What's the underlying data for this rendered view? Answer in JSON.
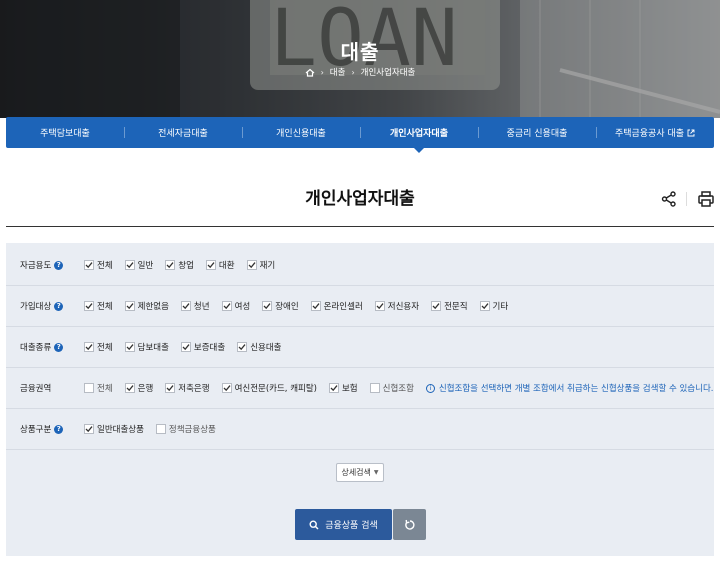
{
  "hero": {
    "title": "대출",
    "breadcrumb": [
      "대출",
      "개인사업자대출"
    ]
  },
  "tabs": [
    {
      "label": "주택담보대출",
      "active": false,
      "external": false
    },
    {
      "label": "전세자금대출",
      "active": false,
      "external": false
    },
    {
      "label": "개인신용대출",
      "active": false,
      "external": false
    },
    {
      "label": "개인사업자대출",
      "active": true,
      "external": false
    },
    {
      "label": "중금리 신용대출",
      "active": false,
      "external": false
    },
    {
      "label": "주택금융공사 대출",
      "active": false,
      "external": true
    }
  ],
  "page": {
    "title": "개인사업자대출"
  },
  "filters": [
    {
      "label": "자금용도",
      "help": true,
      "options": [
        {
          "text": "전체",
          "checked": true
        },
        {
          "text": "일반",
          "checked": true
        },
        {
          "text": "창업",
          "checked": true
        },
        {
          "text": "대환",
          "checked": true
        },
        {
          "text": "재기",
          "checked": true
        }
      ]
    },
    {
      "label": "가입대상",
      "help": true,
      "options": [
        {
          "text": "전체",
          "checked": true
        },
        {
          "text": "제한없음",
          "checked": true
        },
        {
          "text": "청년",
          "checked": true
        },
        {
          "text": "여성",
          "checked": true
        },
        {
          "text": "장애인",
          "checked": true
        },
        {
          "text": "온라인셀러",
          "checked": true
        },
        {
          "text": "저신용자",
          "checked": true
        },
        {
          "text": "전문직",
          "checked": true
        },
        {
          "text": "기타",
          "checked": true
        }
      ]
    },
    {
      "label": "대출종류",
      "help": true,
      "options": [
        {
          "text": "전체",
          "checked": true
        },
        {
          "text": "담보대출",
          "checked": true
        },
        {
          "text": "보증대출",
          "checked": true
        },
        {
          "text": "신용대출",
          "checked": true
        }
      ]
    },
    {
      "label": "금융권역",
      "help": false,
      "options": [
        {
          "text": "전체",
          "checked": false
        },
        {
          "text": "은행",
          "checked": true
        },
        {
          "text": "저축은행",
          "checked": true
        },
        {
          "text": "여신전문(카드, 캐피탈)",
          "checked": true
        },
        {
          "text": "보험",
          "checked": true
        },
        {
          "text": "신협조합",
          "checked": false
        }
      ],
      "info": "신협조합을 선택하면 개별 조합에서 취급하는 신협상품을 검색할 수 있습니다."
    },
    {
      "label": "상품구분",
      "help": true,
      "options": [
        {
          "text": "일반대출상품",
          "checked": true
        },
        {
          "text": "정책금융상품",
          "checked": false
        }
      ]
    }
  ],
  "buttons": {
    "detail_search": "상세검색",
    "search": "금융상품 검색"
  },
  "colors": {
    "primary": "#1d64b8",
    "search_button": "#2c5a9c",
    "reset_button": "#7b8794",
    "panel_bg": "#e9edf3"
  }
}
